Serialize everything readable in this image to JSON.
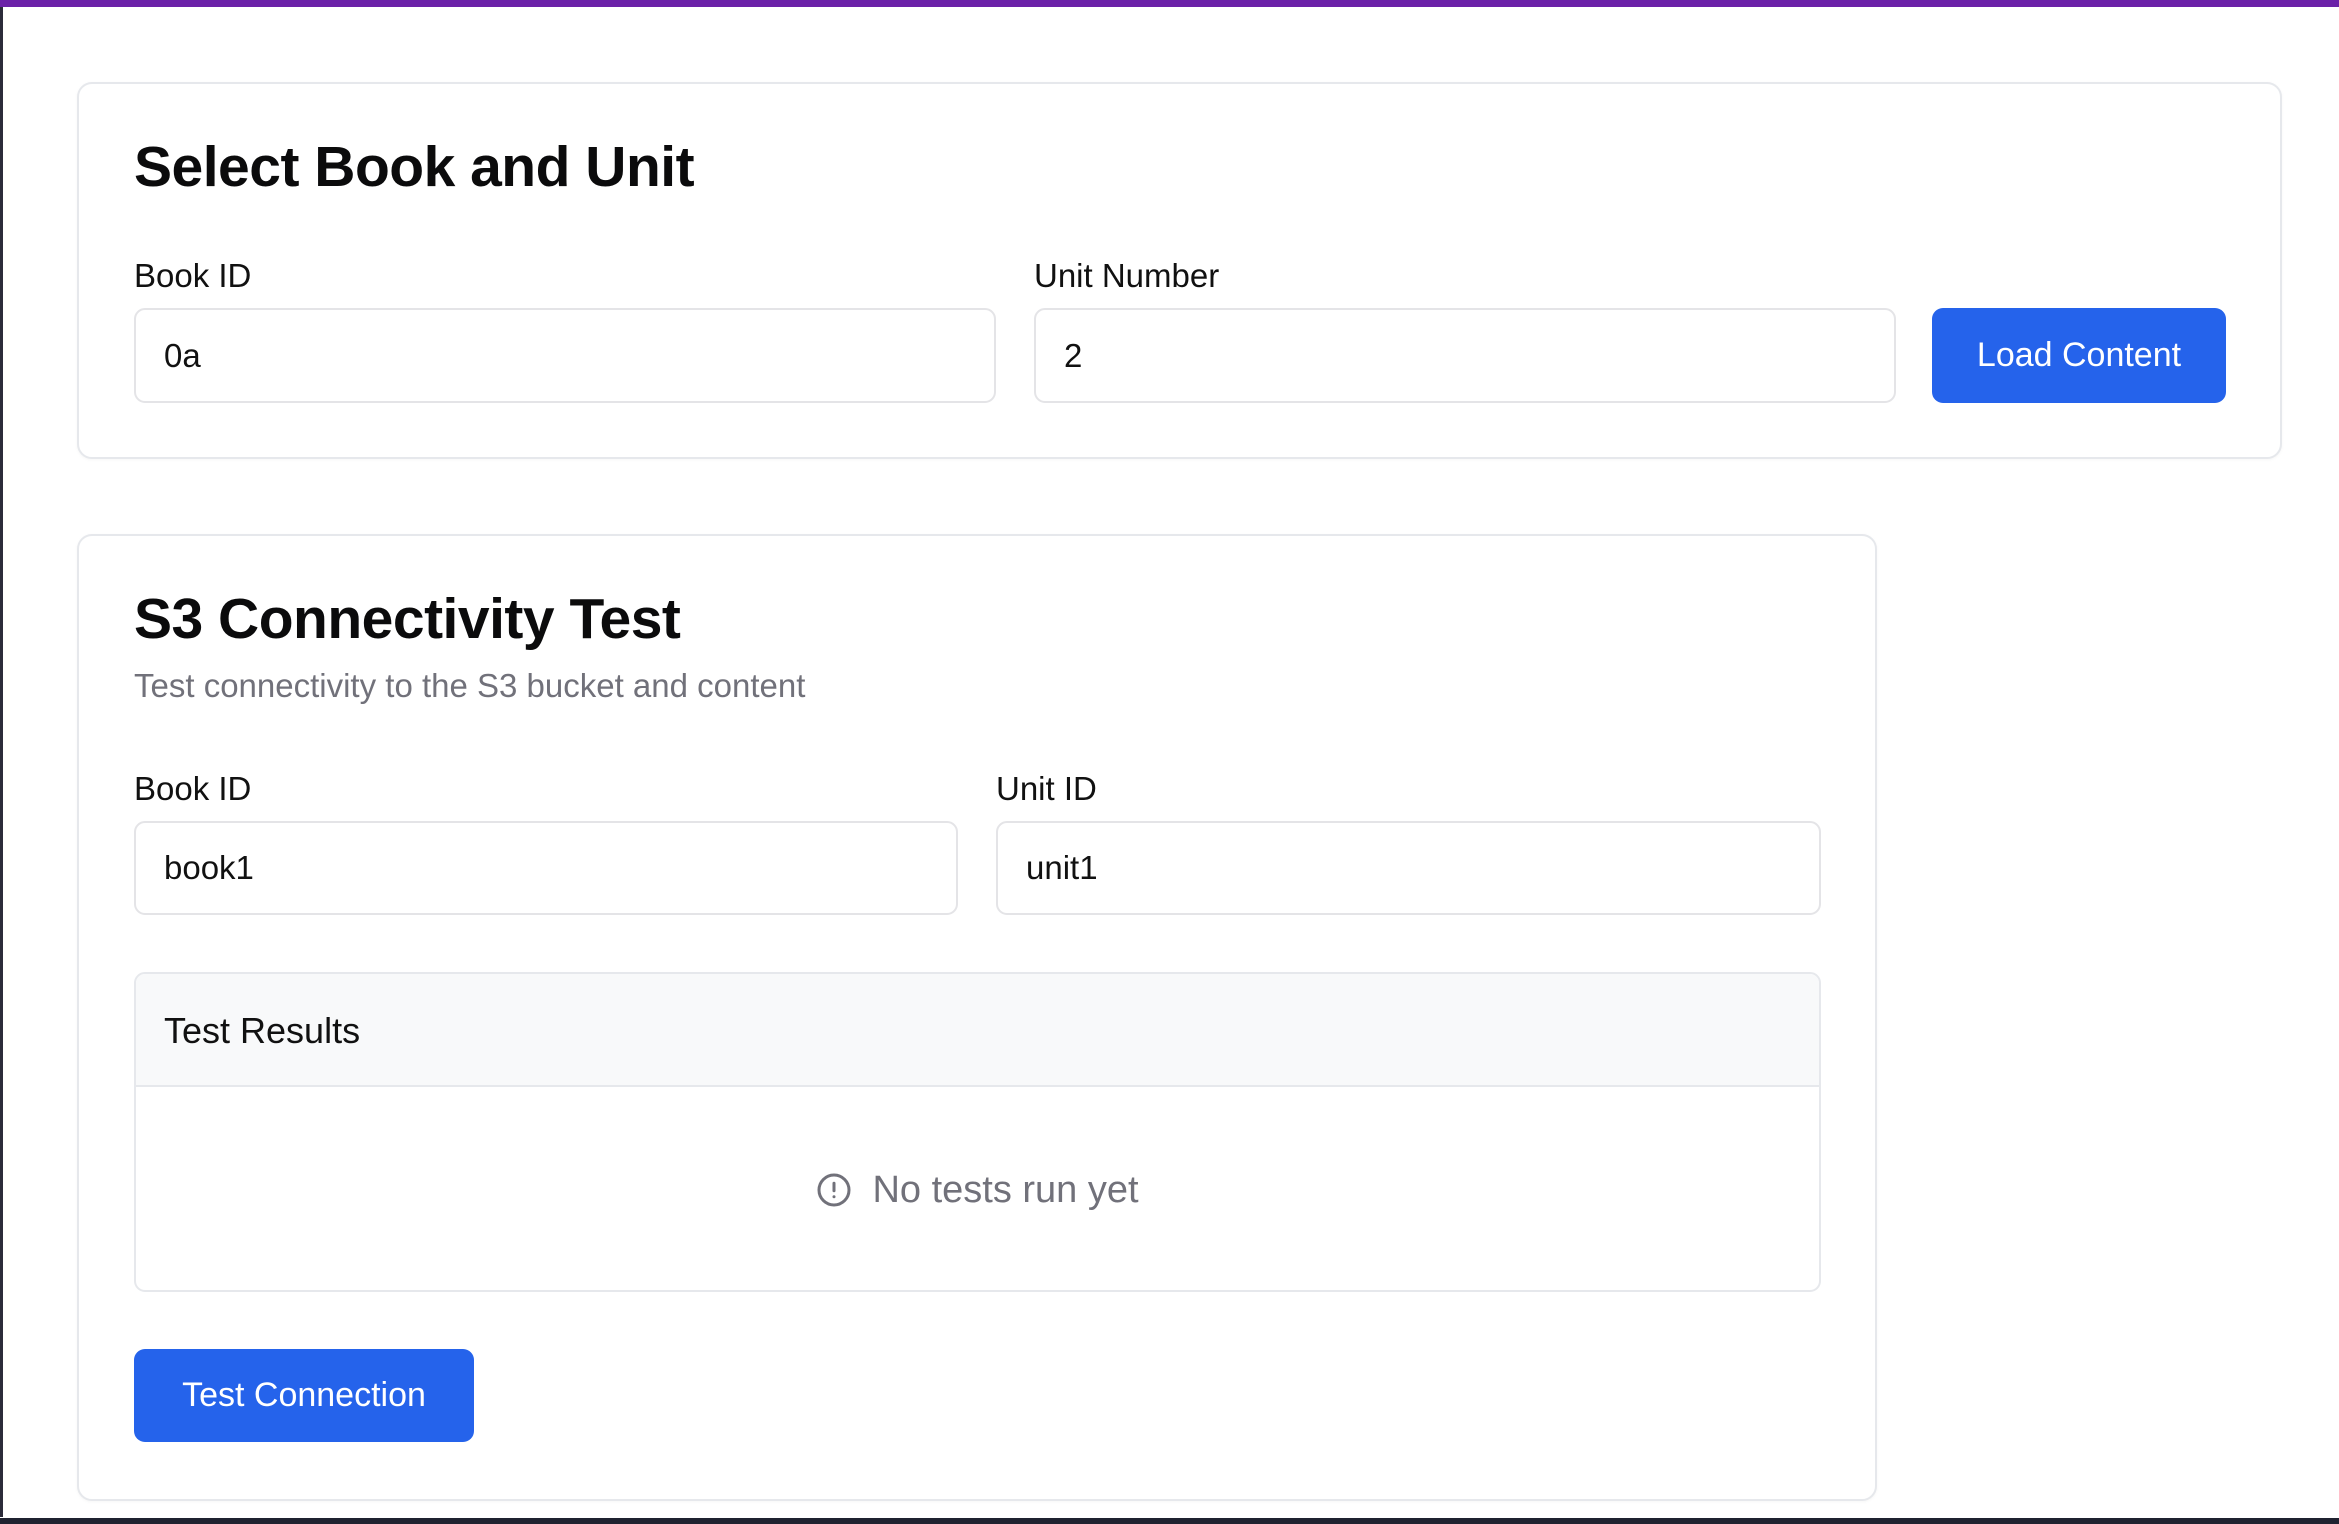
{
  "theme": {
    "accent": "#6b21a8",
    "primary_button": "#2563eb",
    "muted_text": "#71717a"
  },
  "select_card": {
    "title": "Select Book and Unit",
    "book_id_label": "Book ID",
    "book_id_value": "0a",
    "unit_number_label": "Unit Number",
    "unit_number_value": "2",
    "load_button_label": "Load Content"
  },
  "s3_card": {
    "title": "S3 Connectivity Test",
    "subtitle": "Test connectivity to the S3 bucket and content",
    "book_id_label": "Book ID",
    "book_id_value": "book1",
    "unit_id_label": "Unit ID",
    "unit_id_value": "unit1",
    "results_title": "Test Results",
    "empty_icon": "alert-circle-icon",
    "empty_message": "No tests run yet",
    "test_button_label": "Test Connection"
  }
}
